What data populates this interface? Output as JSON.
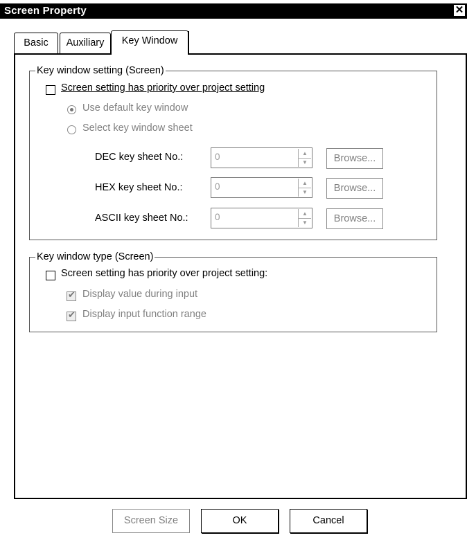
{
  "window": {
    "title": "Screen Property",
    "close_glyph": "✕"
  },
  "tabs": [
    {
      "label": "Basic",
      "active": false
    },
    {
      "label": "Auxiliary",
      "active": false
    },
    {
      "label": "Key Window",
      "active": true
    }
  ],
  "key_window_setting": {
    "title": "Key window setting (Screen)",
    "priority_label": "Screen setting has priority over project setting",
    "radio_default": "Use default key window",
    "radio_select": "Select key window sheet",
    "rows": [
      {
        "label": "DEC key sheet No.:",
        "value": "0",
        "browse": "Browse..."
      },
      {
        "label": "HEX key sheet No.:",
        "value": "0",
        "browse": "Browse..."
      },
      {
        "label": "ASCII key sheet No.:",
        "value": "0",
        "browse": "Browse..."
      }
    ]
  },
  "key_window_type": {
    "title": "Key window type (Screen)",
    "priority_label": "Screen setting has priority over project setting:",
    "display_value": "Display value during input",
    "display_range": "Display input function range"
  },
  "buttons": {
    "screen_size": "Screen Size",
    "ok": "OK",
    "cancel": "Cancel"
  }
}
